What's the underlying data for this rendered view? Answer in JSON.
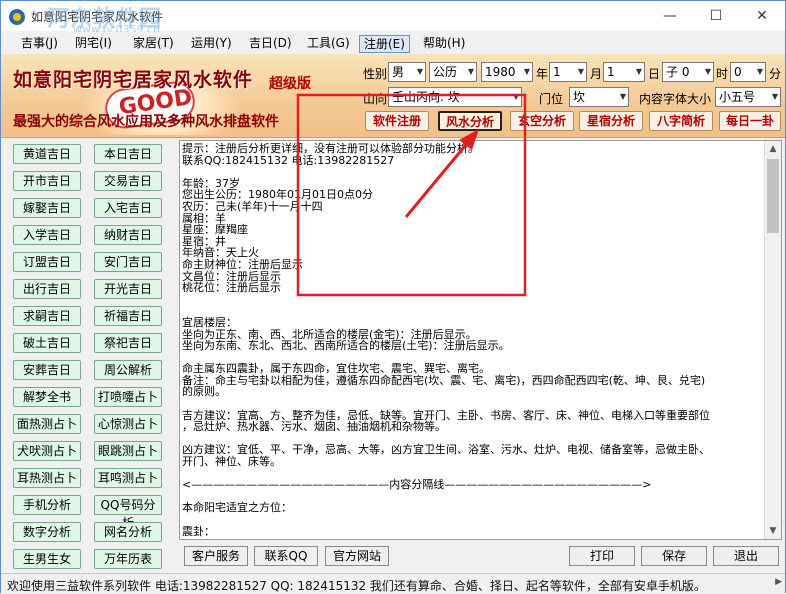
{
  "window": {
    "title": "如意阳宅阴宅家风水软件",
    "watermark": "河东软件园",
    "watermark_url": "www.pc0359.cn",
    "controls": {
      "minimize": "—",
      "maximize": "☐",
      "close": "✕"
    }
  },
  "menu": [
    "吉事(J)",
    "阴宅(I)",
    "家居(T)",
    "运用(Y)",
    "吉日(D)",
    "工具(G)",
    "注册(E)",
    "帮助(H)"
  ],
  "menu_active_index": 6,
  "banner": {
    "brand": "如意阳宅阴宅居家风水软件",
    "edition": "超级版",
    "slogan": "最强大的综合风水应用及多种风水排盘软件",
    "decor_text": "GOOD"
  },
  "form": {
    "gender_label": "性别",
    "gender": "男",
    "calendar": "公历",
    "year": "1980",
    "year_label": "年",
    "month": "1",
    "month_label": "月",
    "day": "1",
    "day_label": "日",
    "hour": "子 0",
    "hour_label": "时",
    "minute": "0",
    "minute_label": "分",
    "mountain_label": "山向",
    "mountain": "壬山丙向: 坎",
    "door_label": "门位",
    "door": "坎",
    "font_label": "内容字体大小",
    "font": "小五号"
  },
  "actions": [
    "软件注册",
    "风水分析",
    "玄空分析",
    "星宿分析",
    "八字简析",
    "每日一卦"
  ],
  "actions_pressed_index": 1,
  "left_buttons": [
    [
      "黄道吉日",
      "本日吉日"
    ],
    [
      "开市吉日",
      "交易吉日"
    ],
    [
      "嫁娶吉日",
      "入宅吉日"
    ],
    [
      "入学吉日",
      "纳财吉日"
    ],
    [
      "订盟吉日",
      "安门吉日"
    ],
    [
      "出行吉日",
      "开光吉日"
    ],
    [
      "求嗣吉日",
      "祈福吉日"
    ],
    [
      "破土吉日",
      "祭祀吉日"
    ],
    [
      "安葬吉日",
      "周公解析"
    ],
    [
      "解梦全书",
      "打喷嚏占卜"
    ],
    [
      "面热测占卜",
      "心惊测占卜"
    ],
    [
      "犬吠测占卜",
      "眼跳测占卜"
    ],
    [
      "耳热测占卜",
      "耳鸣测占卜"
    ],
    [
      "手机分析",
      "QQ号码分析"
    ],
    [
      "数字分析",
      "网名分析"
    ],
    [
      "生男生女",
      "万年历表"
    ]
  ],
  "content_lines": [
    "提示：注册后分析更详细，没有注册可以体验部分功能分析。",
    "联系QQ:182415132 电话:13982281527",
    "",
    "年龄：37岁",
    "您出生公历：1980年01月01日0点0分",
    "农历：己未(羊年)十一月十四",
    "属相：羊",
    "星座：摩羯座",
    "星宿：井",
    "年纳音：天上火",
    "命主财神位：注册后显示",
    "文昌位：注册后显示",
    "桃花位：注册后显示",
    "",
    "",
    "宜居楼层：",
    "坐向为正东、南、西、北所适合的楼层(金宅)：注册后显示。",
    "坐向为东南、东北、西北、西南所适合的楼层(土宅)：注册后显示。",
    "",
    "命主属东四震卦，属于东四命，宜住坎宅、震宅、巽宅、离宅。",
    "备注：命主与宅卦以相配为佳，遵循东四命配西宅(坎、震、宅、离宅)，西四命配西四宅(乾、坤、艮、兑宅)",
    "的原则。",
    "",
    "吉方建议：宜高、方、整齐为佳，忌低、缺等。宜开门、主卧、书房、客厅、床、神位、电梯入口等重要部位",
    "，忌灶炉、热水器、污水、烟囱、抽油烟机和杂物等。",
    "",
    "凶方建议：宜低、平、干净，忌高、大等，凶方宜卫生间、浴室、污水、灶炉、电视、储备室等，忌做主卧、",
    "开门、神位、床等。",
    "",
    "<——————————————————内容分隔线——————————————————>",
    "",
    "本命阳宅适宜之方位：",
    "",
    "震卦："
  ],
  "bottom_buttons": {
    "service": "客户服务",
    "contact_qq": "联系QQ",
    "website": "官方网站",
    "print": "打印",
    "save": "保存",
    "exit": "退出"
  },
  "status_text": "欢迎使用三益软件系列软件 电话:13982281527 QQ: 182415132  我们还有算命、合婚、择日、起名等软件，全部有安卓手机版。",
  "colors": {
    "annotation_red": "#e02020",
    "brand_red": "#8b0000",
    "green_button": "#dff7e6"
  }
}
